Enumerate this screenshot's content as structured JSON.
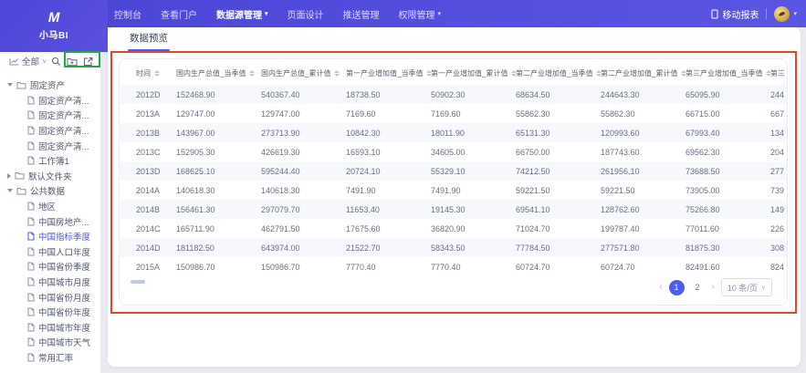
{
  "topnav": {
    "logo_mark": "M",
    "logo_text": "小马BI",
    "items": [
      {
        "label": "控制台",
        "active": false,
        "dropdown": false
      },
      {
        "label": "查看门户",
        "active": false,
        "dropdown": false
      },
      {
        "label": "数据源管理",
        "active": true,
        "dropdown": true
      },
      {
        "label": "页面设计",
        "active": false,
        "dropdown": false
      },
      {
        "label": "推送管理",
        "active": false,
        "dropdown": false
      },
      {
        "label": "权限管理",
        "active": false,
        "dropdown": true
      }
    ],
    "mobile_report_label": "移动报表"
  },
  "sidebar": {
    "filter_label": "全部",
    "tool_icons": [
      "search-icon",
      "new-folder-icon",
      "export-icon"
    ],
    "tree": [
      {
        "type": "folder",
        "label": "固定资产",
        "caret": "down",
        "selected": false
      },
      {
        "type": "file",
        "label": "固定资产清...",
        "selected": false
      },
      {
        "type": "file",
        "label": "固定资产清...",
        "selected": false
      },
      {
        "type": "file",
        "label": "固定资产清...",
        "selected": false
      },
      {
        "type": "file",
        "label": "固定资产清...",
        "selected": false
      },
      {
        "type": "file",
        "label": "工作簿1",
        "selected": false
      },
      {
        "type": "folder",
        "label": "默认文件夹",
        "caret": "right",
        "selected": false
      },
      {
        "type": "folder",
        "label": "公共数据",
        "caret": "down",
        "selected": false
      },
      {
        "type": "file",
        "label": "地区",
        "selected": false
      },
      {
        "type": "file",
        "label": "中国房地产...",
        "selected": false
      },
      {
        "type": "file",
        "label": "中国指标季度",
        "selected": true
      },
      {
        "type": "file",
        "label": "中国人口年度",
        "selected": false
      },
      {
        "type": "file",
        "label": "中国省份季度",
        "selected": false
      },
      {
        "type": "file",
        "label": "中国城市月度",
        "selected": false
      },
      {
        "type": "file",
        "label": "中国省份月度",
        "selected": false
      },
      {
        "type": "file",
        "label": "中国省份年度",
        "selected": false
      },
      {
        "type": "file",
        "label": "中国城市年度",
        "selected": false
      },
      {
        "type": "file",
        "label": "中国城市天气",
        "selected": false
      },
      {
        "type": "file",
        "label": "常用汇率",
        "selected": false
      }
    ]
  },
  "main": {
    "tab_label": "数据预览",
    "table": {
      "columns": [
        {
          "label": "时间",
          "sort": true
        },
        {
          "label": "国内生产总值_当季值",
          "sort": true
        },
        {
          "label": "国内生产总值_累计值",
          "sort": true
        },
        {
          "label": "第一产业增加值_当季值",
          "sort": true
        },
        {
          "label": "第一产业增加值_累计值",
          "sort": true
        },
        {
          "label": "第二产业增加值_当季值",
          "sort": true
        },
        {
          "label": "第二产业增加值_累计值",
          "sort": true
        },
        {
          "label": "第三产业增加值_当季值",
          "sort": true
        },
        {
          "label": "第三",
          "sort": false
        }
      ],
      "rows": [
        [
          "2012D",
          "152468.90",
          "540367.40",
          "18738.50",
          "50902.30",
          "68634.50",
          "244643.30",
          "65095.90",
          "244"
        ],
        [
          "2013A",
          "129747.00",
          "129747.00",
          "7169.60",
          "7169.60",
          "55862.30",
          "55862.30",
          "66715.00",
          "667"
        ],
        [
          "2013B",
          "143967.00",
          "273713.90",
          "10842.30",
          "18011.90",
          "65131.30",
          "120993.60",
          "67993.40",
          "134"
        ],
        [
          "2013C",
          "152905.30",
          "426619.30",
          "16593.10",
          "34605.00",
          "66750.00",
          "187743.60",
          "69562.30",
          "204"
        ],
        [
          "2013D",
          "168625.10",
          "595244.40",
          "20724.10",
          "55329.10",
          "74212.50",
          "261956.10",
          "73688.50",
          "277"
        ],
        [
          "2014A",
          "140618.30",
          "140618.30",
          "7491.90",
          "7491.90",
          "59221.50",
          "59221.50",
          "73905.00",
          "739"
        ],
        [
          "2014B",
          "156461.30",
          "297079.70",
          "11653.40",
          "19145.30",
          "69541.10",
          "128762.60",
          "75266.80",
          "149"
        ],
        [
          "2014C",
          "165711.90",
          "462791.50",
          "17675.60",
          "36820.90",
          "71024.70",
          "199787.40",
          "77011.60",
          "226"
        ],
        [
          "2014D",
          "181182.50",
          "643974.00",
          "21522.70",
          "58343.50",
          "77784.50",
          "277571.80",
          "81875.30",
          "308"
        ],
        [
          "2015A",
          "150986.70",
          "150986.70",
          "7770.40",
          "7770.40",
          "60724.70",
          "60724.70",
          "82491.60",
          "824"
        ]
      ]
    },
    "pagination": {
      "prev": "‹",
      "next": "›",
      "pages": [
        {
          "label": "1",
          "active": true
        },
        {
          "label": "2",
          "active": false
        }
      ],
      "page_size": "10 条/页"
    }
  },
  "annotations": {
    "red_box_color": "#e8422c",
    "green_box_color": "#26a73f"
  },
  "colors": {
    "navbar_gradient_start": "#4a44d5",
    "navbar_gradient_end": "#5a55e3",
    "accent_blue": "#4c5af0",
    "active_page_blue": "#4d5cf2",
    "selected_tree_item": "#5356e2",
    "row_alt_background": "#f7f8fc"
  }
}
